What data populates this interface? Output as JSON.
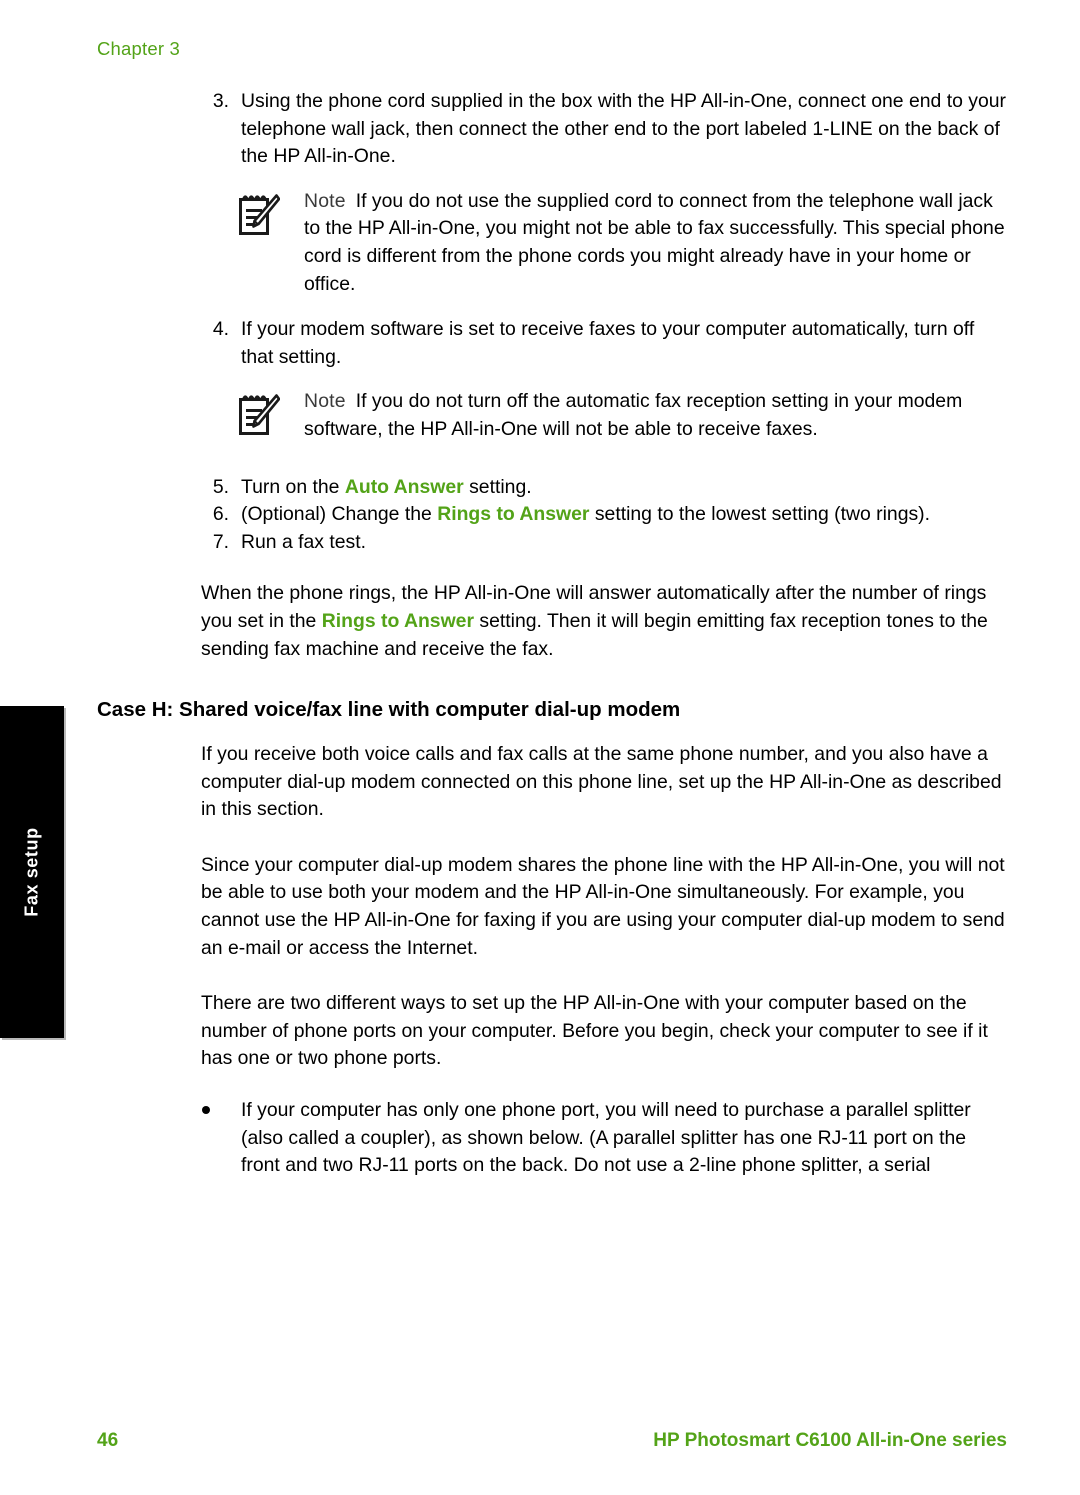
{
  "page": {
    "chapter_label": "Chapter 3",
    "side_tab_label": "Fax setup"
  },
  "steps": [
    {
      "number": "3.",
      "text": "Using the phone cord supplied in the box with the HP All-in-One, connect one end to your telephone wall jack, then connect the other end to the port labeled 1-LINE on the back of the HP All-in-One."
    },
    {
      "number": "4.",
      "text": "If your modem software is set to receive faxes to your computer automatically, turn off that setting."
    },
    {
      "number": "5.",
      "text_before": "Turn on the ",
      "highlight": "Auto Answer",
      "text_after": " setting."
    },
    {
      "number": "6.",
      "text_before": "(Optional) Change the ",
      "highlight": "Rings to Answer",
      "text_after": " setting to the lowest setting (two rings)."
    },
    {
      "number": "7.",
      "text": "Run a fax test."
    }
  ],
  "notes": [
    {
      "label": "Note",
      "icon": "note-pad-pencil-icon",
      "text": "If you do not use the supplied cord to connect from the telephone wall jack to the HP All-in-One, you might not be able to fax successfully. This special phone cord is different from the phone cords you might already have in your home or office."
    },
    {
      "label": "Note",
      "icon": "note-pad-pencil-icon",
      "text": "If you do not turn off the automatic fax reception setting in your modem software, the HP All-in-One will not be able to receive faxes."
    }
  ],
  "closing_paragraph": {
    "text_before": "When the phone rings, the HP All-in-One will answer automatically after the number of rings you set in the ",
    "highlight": "Rings to Answer",
    "text_after": " setting. Then it will begin emitting fax reception tones to the sending fax machine and receive the fax."
  },
  "section": {
    "heading": "Case H: Shared voice/fax line with computer dial-up modem",
    "paragraphs": [
      "If you receive both voice calls and fax calls at the same phone number, and you also have a computer dial-up modem connected on this phone line, set up the HP All-in-One as described in this section.",
      "Since your computer dial-up modem shares the phone line with the HP All-in-One, you will not be able to use both your modem and the HP All-in-One simultaneously. For example, you cannot use the HP All-in-One for faxing if you are using your computer dial-up modem to send an e-mail or access the Internet.",
      "There are two different ways to set up the HP All-in-One with your computer based on the number of phone ports on your computer. Before you begin, check your computer to see if it has one or two phone ports."
    ],
    "bullets": [
      "If your computer has only one phone port, you will need to purchase a parallel splitter (also called a coupler), as shown below. (A parallel splitter has one RJ-11 port on the front and two RJ-11 ports on the back. Do not use a 2-line phone splitter, a serial"
    ]
  },
  "footer": {
    "page_number": "46",
    "product_title": "HP Photosmart C6100 All-in-One series"
  },
  "colors": {
    "accent_green": "#53a318",
    "body_black": "#000000",
    "note_label_gray": "#3a3a3a",
    "tab_black": "#000000"
  }
}
